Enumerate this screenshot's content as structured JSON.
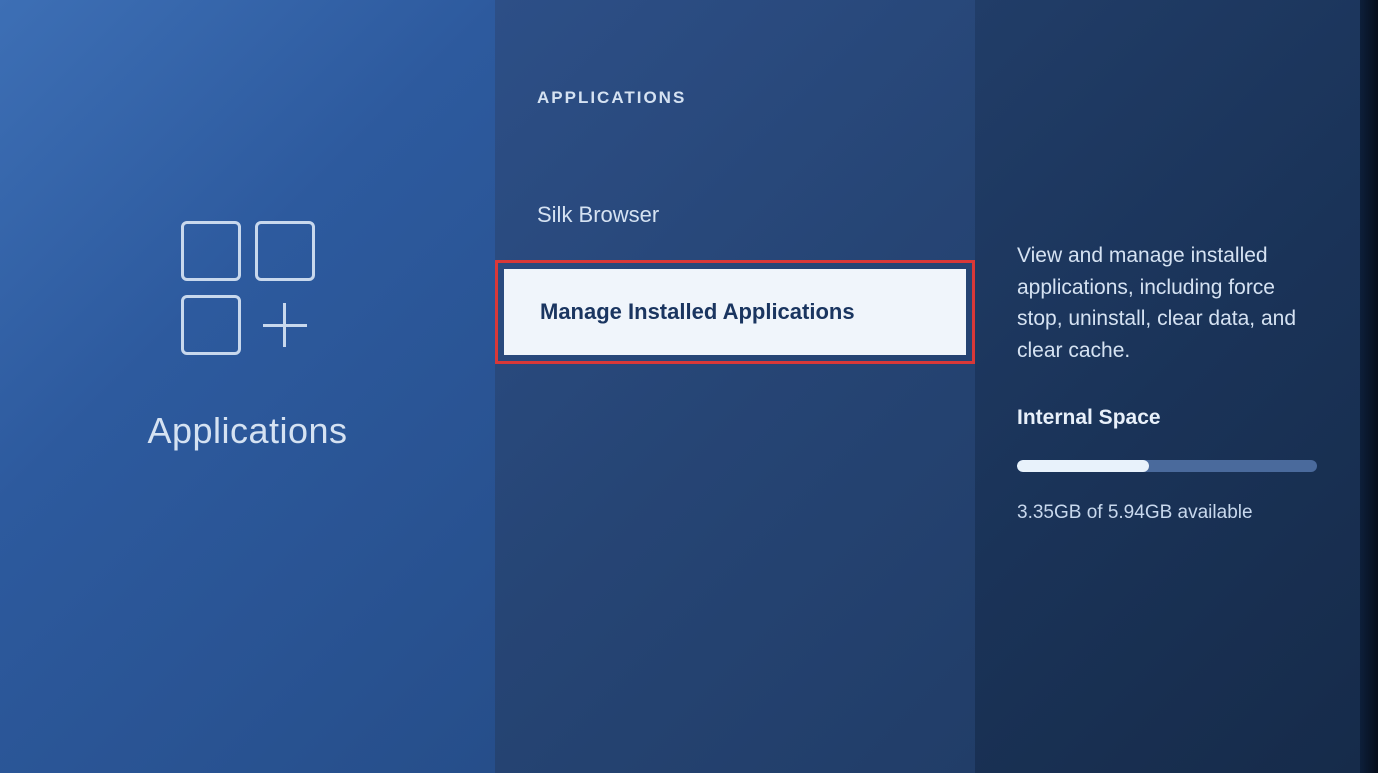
{
  "left": {
    "title": "Applications"
  },
  "middle": {
    "header": "APPLICATIONS",
    "items": [
      {
        "label": "Silk Browser",
        "selected": false
      },
      {
        "label": "Manage Installed Applications",
        "selected": true
      }
    ]
  },
  "right": {
    "description": "View and manage installed applications, including force stop, uninstall, clear data, and clear cache.",
    "storage_label": "Internal Space",
    "storage_text": "3.35GB of 5.94GB available",
    "storage_percent": 44
  }
}
